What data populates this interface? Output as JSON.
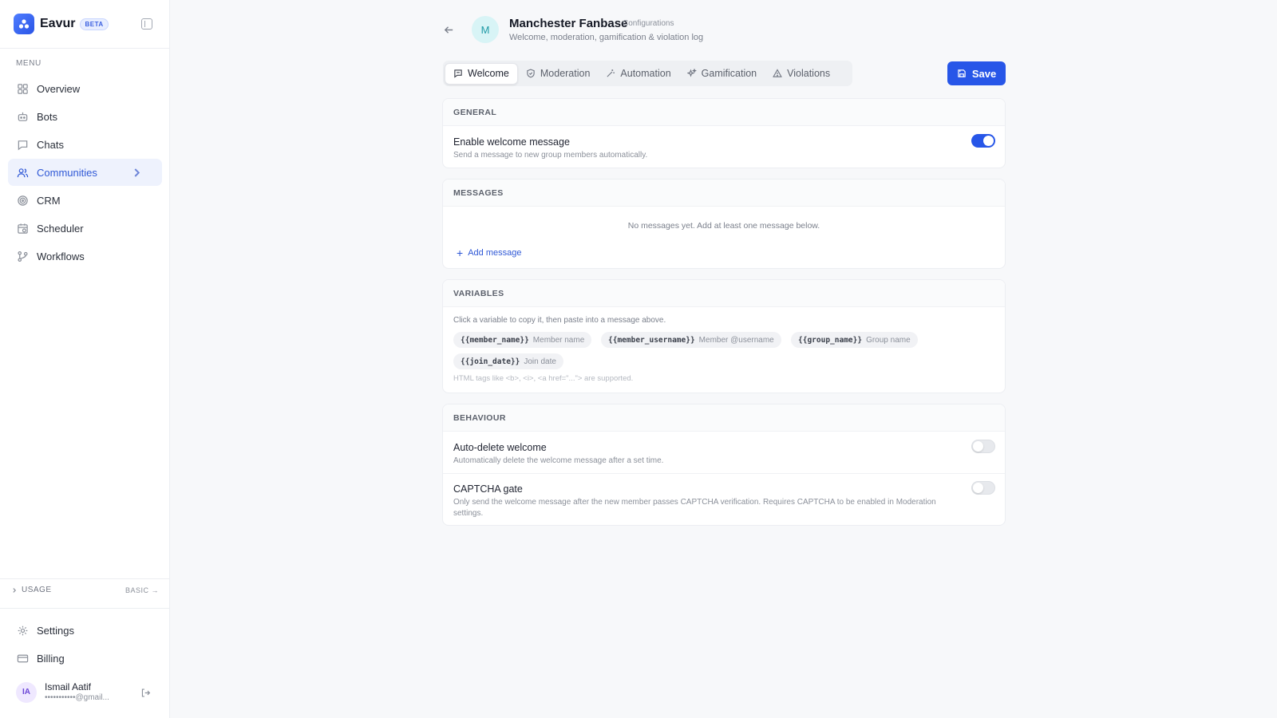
{
  "app": {
    "name": "Eavur",
    "badge": "BETA"
  },
  "sidebar": {
    "menu_title": "MENU",
    "items": [
      {
        "label": "Overview",
        "icon": "grid-icon"
      },
      {
        "label": "Bots",
        "icon": "bot-icon"
      },
      {
        "label": "Chats",
        "icon": "chat-icon"
      },
      {
        "label": "Communities",
        "icon": "users-icon",
        "active": true
      },
      {
        "label": "CRM",
        "icon": "target-icon"
      },
      {
        "label": "Scheduler",
        "icon": "calendar-icon"
      },
      {
        "label": "Workflows",
        "icon": "workflow-icon"
      }
    ],
    "usage": {
      "label": "USAGE",
      "plan": "BASIC →"
    },
    "footer_items": [
      {
        "label": "Settings",
        "icon": "gear-icon"
      },
      {
        "label": "Billing",
        "icon": "card-icon"
      }
    ],
    "user": {
      "initials": "IA",
      "name": "Ismail Aatif",
      "email": "•••••••••••@gmail..."
    }
  },
  "header": {
    "avatar_letter": "M",
    "title": "Manchester Fanbase",
    "crumb": "Configurations",
    "subtitle": "Welcome, moderation, gamification & violation log"
  },
  "tabs": [
    {
      "label": "Welcome",
      "icon": "message-square-icon",
      "active": true
    },
    {
      "label": "Moderation",
      "icon": "shield-icon"
    },
    {
      "label": "Automation",
      "icon": "wand-icon"
    },
    {
      "label": "Gamification",
      "icon": "sparkles-icon"
    },
    {
      "label": "Violations",
      "icon": "warning-icon"
    }
  ],
  "save_label": "Save",
  "general": {
    "heading": "GENERAL",
    "title": "Enable welcome message",
    "desc": "Send a message to new group members automatically.",
    "enabled": true
  },
  "messages": {
    "heading": "MESSAGES",
    "empty": "No messages yet. Add at least one message below.",
    "add_label": "Add message"
  },
  "variables": {
    "heading": "VARIABLES",
    "hint": "Click a variable to copy it, then paste into a message above.",
    "chips": [
      {
        "code": "{{member_name}}",
        "label": "Member name"
      },
      {
        "code": "{{member_username}}",
        "label": "Member @username"
      },
      {
        "code": "{{group_name}}",
        "label": "Group name"
      },
      {
        "code": "{{join_date}}",
        "label": "Join date"
      }
    ],
    "html_hint": "HTML tags like <b>, <i>, <a href=\"...\"> are supported."
  },
  "behaviour": {
    "heading": "BEHAVIOUR",
    "rows": [
      {
        "title": "Auto-delete welcome",
        "desc": "Automatically delete the welcome message after a set time.",
        "enabled": false
      },
      {
        "title": "CAPTCHA gate",
        "desc": "Only send the welcome message after the new member passes CAPTCHA verification. Requires CAPTCHA to be enabled in Moderation settings.",
        "enabled": false
      }
    ]
  },
  "colors": {
    "accent": "#2756e8",
    "active_nav_bg": "#eef2fd"
  }
}
